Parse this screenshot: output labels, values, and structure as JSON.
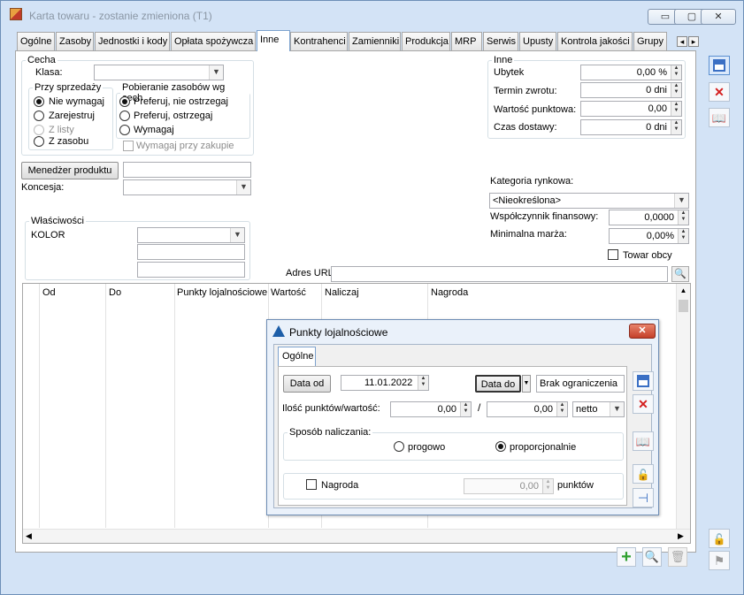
{
  "window": {
    "title": "Karta towaru - zostanie zmieniona (T1)",
    "controls": [
      "▭",
      "▢",
      "✕"
    ]
  },
  "tabs": [
    "Ogólne",
    "Zasoby",
    "Jednostki i kody",
    "Opłata spożywcza",
    "Inne",
    "Kontrahenci",
    "Zamienniki",
    "Produkcja",
    "MRP",
    "Serwis",
    "Upusty",
    "Kontrola jakości",
    "Grupy"
  ],
  "active_tab": "Inne",
  "tab_scroll": {
    "left": "◂",
    "right": "▸"
  },
  "cecha": {
    "legend": "Cecha",
    "klasa_label": "Klasa:",
    "klasa_value": "",
    "przy_sprzedazy": {
      "legend": "Przy sprzedaży",
      "options": [
        "Nie wymagaj",
        "Zarejestruj",
        "Z listy",
        "Z zasobu"
      ]
    },
    "pobieranie": {
      "legend": "Pobieranie zasobów wg cech",
      "options": [
        "Preferuj, nie ostrzegaj",
        "Preferuj, ostrzegaj",
        "Wymagaj"
      ]
    },
    "wymagaj_przy_zakupie": "Wymagaj przy zakupie"
  },
  "inne": {
    "legend": "Inne",
    "ubytek": {
      "label": "Ubytek",
      "value": "0,00 %"
    },
    "termin_zwrotu": {
      "label": "Termin zwrotu:",
      "value": "0 dni"
    },
    "wartosc_punktowa": {
      "label": "Wartość punktowa:",
      "value": "0,00"
    },
    "czas_dostawy": {
      "label": "Czas dostawy:",
      "value": "0 dni"
    }
  },
  "menedzer": {
    "button": "Menedżer produktu",
    "value": ""
  },
  "koncesja": {
    "label": "Koncesja:",
    "value": ""
  },
  "kategoria": {
    "label": "Kategoria rynkowa:",
    "value": "<Nieokreślona>"
  },
  "wspolczynnik": {
    "label": "Współczynnik finansowy:",
    "value": "0,0000"
  },
  "minimalna_marza": {
    "label": "Minimalna marża:",
    "value": "0,00%"
  },
  "towar_obcy": "Towar obcy",
  "wlasciwosci": {
    "legend": "Właściwości",
    "name": "KOLOR"
  },
  "adres_url": {
    "label": "Adres URL",
    "value": ""
  },
  "grid": {
    "columns": [
      "Od",
      "Do",
      "Punkty lojalnościowe",
      "Wartość",
      "Naliczaj",
      "Nagroda"
    ]
  },
  "dialog": {
    "title": "Punkty lojalnościowe",
    "tab": "Ogólne",
    "data_od_button": "Data od",
    "data_od_value": "11.01.2022",
    "data_do_button": "Data do",
    "data_do_value": "Brak ograniczenia",
    "ilosc_label": "Ilość punktów/wartość:",
    "ilosc_value1": "0,00",
    "slash": "/",
    "ilosc_value2": "0,00",
    "netto": "netto",
    "sposob_legend": "Sposób naliczania:",
    "options": [
      "progowo",
      "proporcjonalnie"
    ],
    "nagroda_label": "Nagroda",
    "nagroda_value": "0,00",
    "punktow": "punktów"
  }
}
